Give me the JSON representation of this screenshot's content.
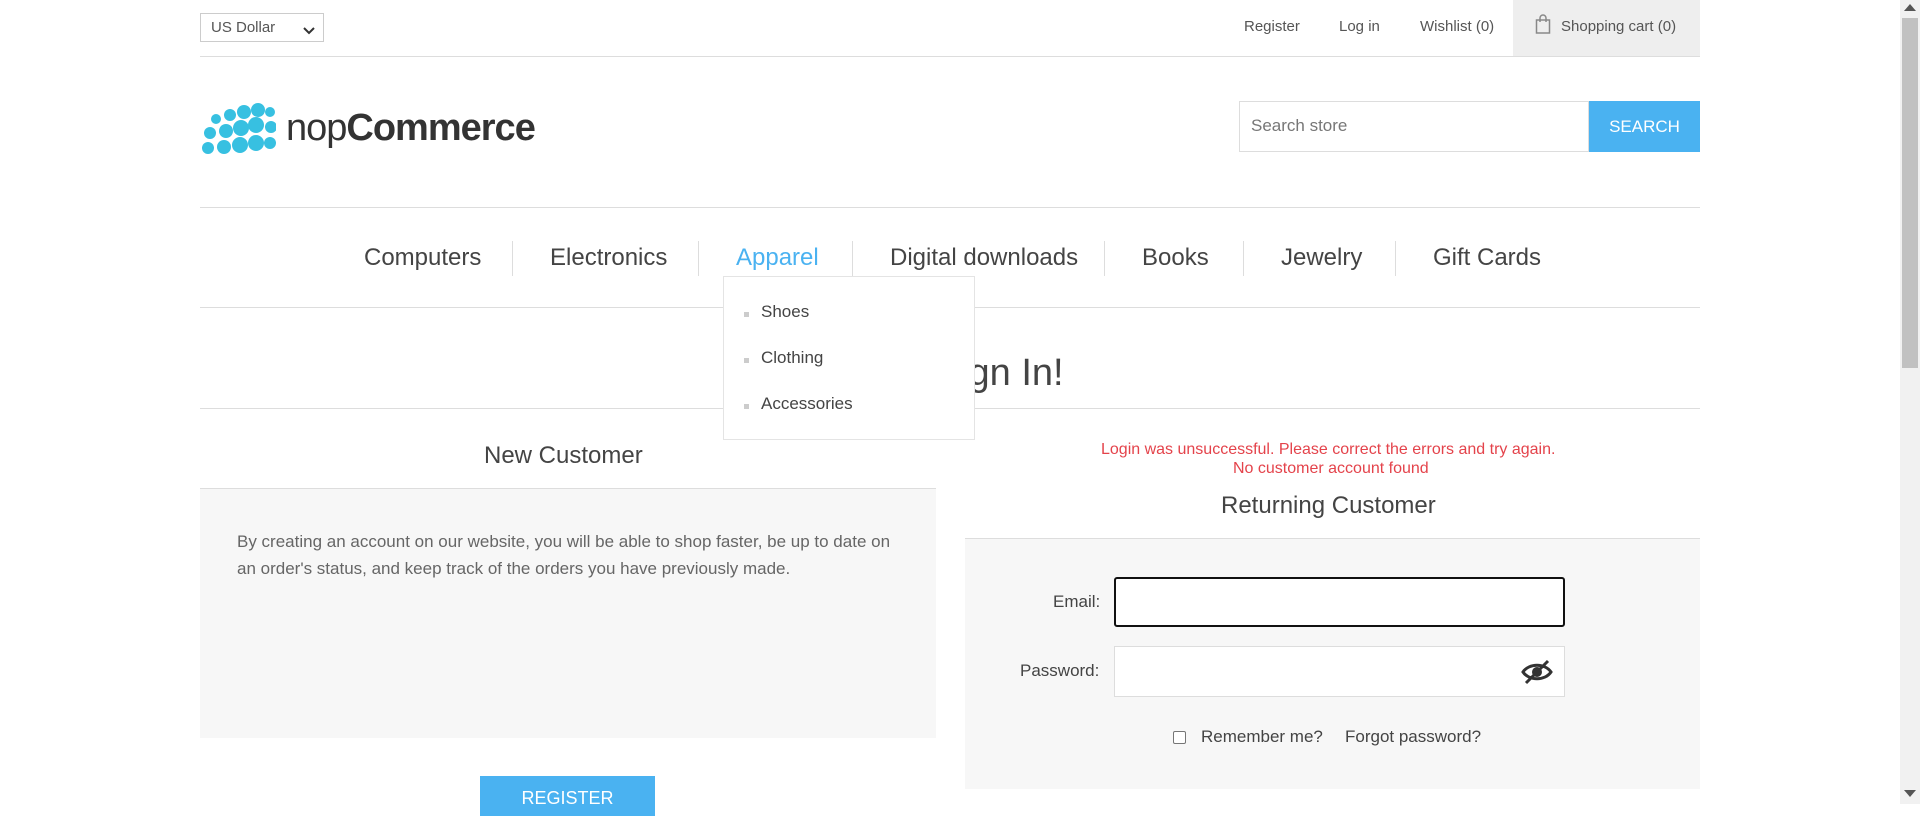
{
  "header": {
    "currency": {
      "selected": "US Dollar"
    },
    "links": {
      "register": "Register",
      "login": "Log in",
      "wishlist": "Wishlist (0)",
      "cart": "Shopping cart (0)"
    }
  },
  "logo": {
    "prefix": "nop",
    "suffix": "Commerce"
  },
  "search": {
    "placeholder": "Search store",
    "button": "SEARCH"
  },
  "nav": {
    "items": [
      "Computers",
      "Electronics",
      "Apparel",
      "Digital downloads",
      "Books",
      "Jewelry",
      "Gift Cards"
    ],
    "active": "Apparel"
  },
  "dropdown": {
    "items": [
      "Shoes",
      "Clothing",
      "Accessories"
    ]
  },
  "page": {
    "title": "Please Sign In!"
  },
  "new_customer": {
    "title": "New Customer",
    "text": "By creating an account on our website, you will be able to shop faster, be up to date on an order's status, and keep track of the orders you have previously made.",
    "register_button": "REGISTER"
  },
  "returning_customer": {
    "error_line1": "Login was unsuccessful. Please correct the errors and try again.",
    "error_line2": "No customer account found",
    "title": "Returning Customer",
    "email_label": "Email:",
    "email_value": "",
    "password_label": "Password:",
    "password_value": "",
    "remember_label": "Remember me?",
    "forgot_label": "Forgot password?"
  },
  "colors": {
    "accent": "#4ab2f1",
    "error": "#e4434b",
    "logo_dots": "#37c0e1"
  }
}
